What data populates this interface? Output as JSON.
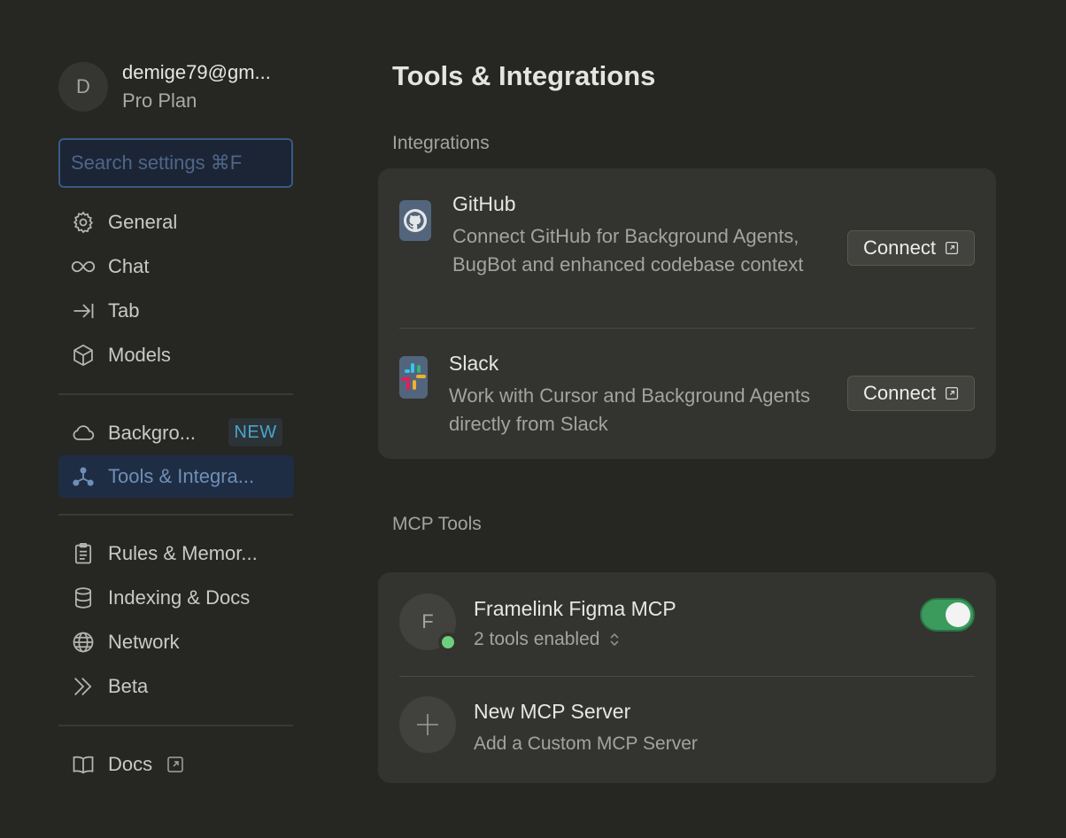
{
  "profile": {
    "avatar_letter": "D",
    "email": "demige79@gm...",
    "plan": "Pro Plan"
  },
  "search": {
    "placeholder": "Search settings ⌘F"
  },
  "sidebar": {
    "items": [
      {
        "label": "General",
        "icon": "gear-icon"
      },
      {
        "label": "Chat",
        "icon": "infinity-icon"
      },
      {
        "label": "Tab",
        "icon": "arrow-to-bar-icon"
      },
      {
        "label": "Models",
        "icon": "cube-icon"
      },
      {
        "label": "Backgro...",
        "icon": "cloud-icon",
        "badge": "NEW"
      },
      {
        "label": "Tools & Integra...",
        "icon": "nodes-icon",
        "active": true
      },
      {
        "label": "Rules & Memor...",
        "icon": "clipboard-icon"
      },
      {
        "label": "Indexing & Docs",
        "icon": "database-icon"
      },
      {
        "label": "Network",
        "icon": "globe-icon"
      },
      {
        "label": "Beta",
        "icon": "double-chevron-icon"
      },
      {
        "label": "Docs",
        "icon": "book-icon"
      }
    ]
  },
  "main": {
    "title": "Tools & Integrations",
    "integrations_title": "Integrations",
    "integrations": [
      {
        "name": "GitHub",
        "description": "Connect GitHub for Background Agents, BugBot and enhanced codebase context",
        "button": "Connect"
      },
      {
        "name": "Slack",
        "description": "Work with Cursor and Background Agents directly from Slack",
        "button": "Connect"
      }
    ],
    "mcp_title": "MCP Tools",
    "mcp": {
      "server": {
        "avatar_letter": "F",
        "name": "Framelink Figma MCP",
        "tools": "2 tools enabled",
        "enabled": true
      },
      "new": {
        "name": "New MCP Server",
        "description": "Add a Custom MCP Server"
      }
    }
  },
  "colors": {
    "background": "#262622",
    "card": "#33332f",
    "accent": "#3a5a86",
    "toggle_on": "#3a9b5d",
    "status_online": "#6fcf7f",
    "badge_text": "#4aa5cc"
  }
}
